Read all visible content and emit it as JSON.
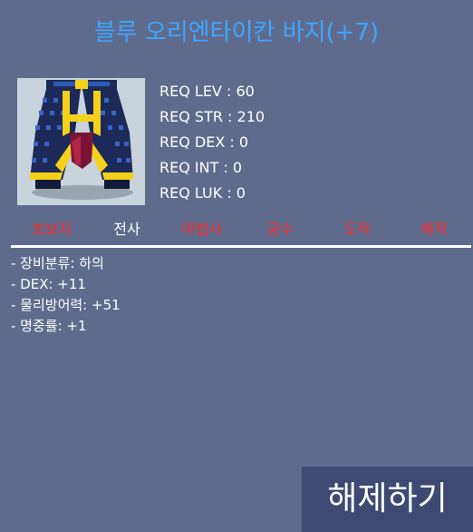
{
  "item": {
    "name": "블루 오리엔타이칸 바지(+7)",
    "icon": "pants-icon"
  },
  "requirements": [
    {
      "label": "REQ LEV : 60"
    },
    {
      "label": "REQ STR : 210"
    },
    {
      "label": "REQ DEX : 0"
    },
    {
      "label": "REQ INT : 0"
    },
    {
      "label": "REQ LUK : 0"
    }
  ],
  "jobs": [
    {
      "label": "초보자",
      "available": false
    },
    {
      "label": "전사",
      "available": true
    },
    {
      "label": "마법사",
      "available": false
    },
    {
      "label": "궁수",
      "available": false
    },
    {
      "label": "도적",
      "available": false
    },
    {
      "label": "해적",
      "available": false
    }
  ],
  "stats": [
    "- 장비분류: 하의",
    "- DEX: +11",
    "- 물리방어력: +51",
    "- 명중률: +1"
  ],
  "actions": {
    "unequip_label": "해제하기"
  },
  "colors": {
    "background": "#5f6b8d",
    "title": "#3fa6ff",
    "job_available": "#ffffff",
    "job_unavailable": "#ff2a2a",
    "button": "#3e4a72"
  }
}
